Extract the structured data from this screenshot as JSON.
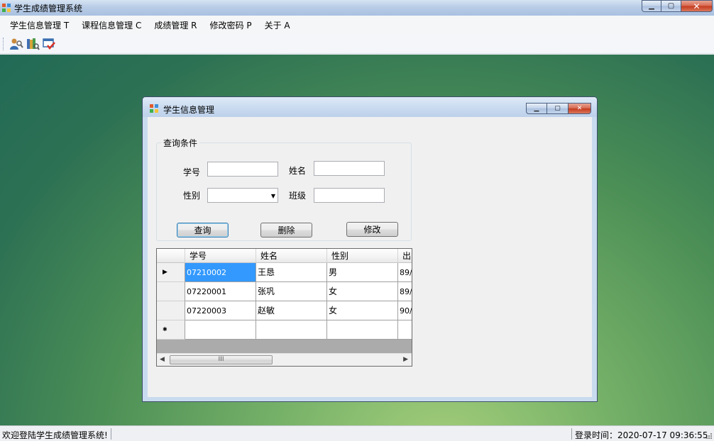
{
  "window": {
    "title": "学生成绩管理系统",
    "caption_buttons": [
      "minimize",
      "maximize",
      "close"
    ]
  },
  "menu": {
    "items": [
      {
        "label": "学生信息管理 T"
      },
      {
        "label": "课程信息管理 C"
      },
      {
        "label": "成绩管理 R"
      },
      {
        "label": "修改密码 P"
      },
      {
        "label": "关于 A"
      }
    ]
  },
  "toolbar": {
    "buttons": [
      "student-info-icon",
      "course-info-icon",
      "grade-check-icon"
    ]
  },
  "child": {
    "title": "学生信息管理",
    "group": {
      "legend": "查询条件",
      "student_id_label": "学号",
      "name_label": "姓名",
      "gender_label": "性别",
      "class_label": "班级",
      "student_id_value": "",
      "name_value": "",
      "gender_value": "",
      "class_value": ""
    },
    "buttons": {
      "query": "查询",
      "delete": "删除",
      "edit": "修改"
    },
    "grid": {
      "columns": [
        "学号",
        "姓名",
        "性别",
        "出"
      ],
      "rows": [
        [
          "07210002",
          "王恳",
          "男",
          "89/"
        ],
        [
          "07220001",
          "张巩",
          "女",
          "89/"
        ],
        [
          "07220003",
          "赵敏",
          "女",
          "90/"
        ]
      ],
      "scroll_glyph": "III"
    }
  },
  "status": {
    "left": "欢迎登陆学生成绩管理系统!",
    "right": "登录时间：2020-07-17 09:36:55"
  },
  "colors": {
    "selection": "#3399ff",
    "desktop": "#4c8f56"
  }
}
